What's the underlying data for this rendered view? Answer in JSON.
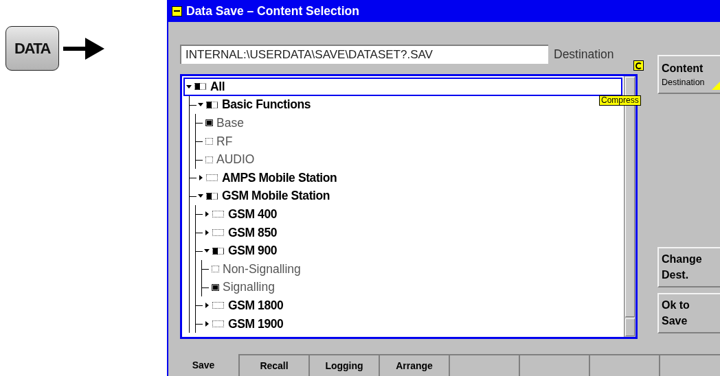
{
  "hard_key": {
    "label": "DATA"
  },
  "window": {
    "title": "Data Save – Content Selection"
  },
  "destination": {
    "value": "INTERNAL:\\USERDATA\\SAVE\\DATASET?.SAV",
    "label": "Destination"
  },
  "compress_badge": "Compress",
  "tree": [
    {
      "label": "All",
      "kind": "group",
      "expanded": true,
      "checked": false,
      "mixed": true,
      "selected": true,
      "children": [
        {
          "label": "Basic Functions",
          "kind": "group",
          "expanded": true,
          "checked": false,
          "mixed": true,
          "selected": false,
          "children": [
            {
              "label": "Base",
              "kind": "item",
              "checked": true,
              "mixed": false,
              "selected": false
            },
            {
              "label": "RF",
              "kind": "item",
              "checked": false,
              "mixed": false,
              "selected": false
            },
            {
              "label": "AUDIO",
              "kind": "item",
              "checked": false,
              "mixed": false,
              "selected": false
            }
          ]
        },
        {
          "label": "AMPS Mobile Station",
          "kind": "group",
          "expanded": false,
          "checked": false,
          "mixed": false,
          "selected": false
        },
        {
          "label": "GSM Mobile Station",
          "kind": "group",
          "expanded": true,
          "checked": false,
          "mixed": true,
          "selected": false,
          "children": [
            {
              "label": "GSM 400",
              "kind": "group",
              "expanded": false,
              "checked": false,
              "mixed": false,
              "selected": false
            },
            {
              "label": "GSM 850",
              "kind": "group",
              "expanded": false,
              "checked": false,
              "mixed": false,
              "selected": false
            },
            {
              "label": "GSM 900",
              "kind": "group",
              "expanded": true,
              "checked": false,
              "mixed": true,
              "selected": false,
              "children": [
                {
                  "label": "Non-Signalling",
                  "kind": "item",
                  "checked": false,
                  "mixed": false,
                  "selected": false
                },
                {
                  "label": "Signalling",
                  "kind": "item",
                  "checked": true,
                  "mixed": false,
                  "selected": false
                }
              ]
            },
            {
              "label": "GSM 1800",
              "kind": "group",
              "expanded": false,
              "checked": false,
              "mixed": false,
              "selected": false
            },
            {
              "label": "GSM 1900",
              "kind": "group",
              "expanded": false,
              "checked": false,
              "mixed": false,
              "selected": false
            }
          ]
        }
      ]
    }
  ],
  "softkeys_top": [
    {
      "label": "Content",
      "subtitle": "Destination"
    }
  ],
  "softkeys_bottom": [
    {
      "label": "Change Dest."
    },
    {
      "label": "Ok to Save"
    }
  ],
  "tabs": [
    {
      "label": "Save",
      "selected": true
    },
    {
      "label": "Recall",
      "selected": false
    },
    {
      "label": "Logging",
      "selected": false
    },
    {
      "label": "Arrange",
      "selected": false
    }
  ]
}
